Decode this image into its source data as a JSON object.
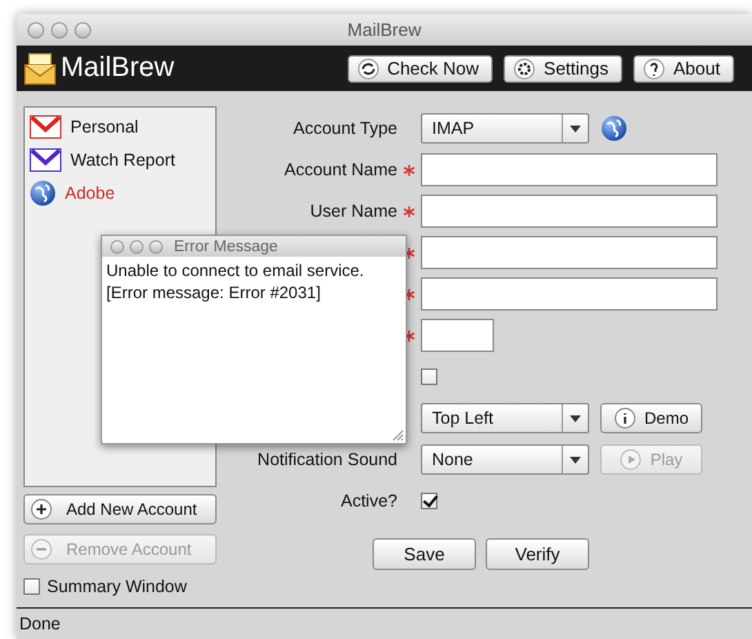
{
  "window": {
    "title": "MailBrew"
  },
  "header": {
    "app_name": "MailBrew",
    "buttons": [
      {
        "label": "Check Now",
        "kind": "refresh"
      },
      {
        "label": "Settings",
        "kind": "gear"
      },
      {
        "label": "About",
        "kind": "help"
      }
    ]
  },
  "accounts": [
    {
      "name": "Personal",
      "kind": "gmail",
      "error": false
    },
    {
      "name": "Watch Report",
      "kind": "mail",
      "error": false
    },
    {
      "name": "Adobe",
      "kind": "globe",
      "error": true
    }
  ],
  "account_buttons": [
    {
      "label": "Add New Account",
      "kind": "add",
      "disabled": false
    },
    {
      "label": "Remove Account",
      "kind": "remove",
      "disabled": true
    }
  ],
  "summary_window": {
    "label": "Summary Window",
    "checked": false
  },
  "form": {
    "rows": [
      {
        "kind": "service_select",
        "label": "Account Type",
        "required": false,
        "value": "IMAP"
      },
      {
        "kind": "text",
        "label": "Account Name",
        "required": true
      },
      {
        "kind": "text",
        "label": "User Name",
        "required": true
      },
      {
        "kind": "text",
        "required": true
      },
      {
        "kind": "text",
        "required": true
      },
      {
        "kind": "short",
        "required": true
      },
      {
        "kind": "checkbox",
        "checked": false
      },
      {
        "kind": "select",
        "value": "Top Left",
        "button": {
          "label": "Demo",
          "kind": "info",
          "disabled": false
        }
      },
      {
        "kind": "select",
        "label": "Notification Sound",
        "value": "None",
        "button": {
          "label": "Play",
          "kind": "play",
          "disabled": true
        }
      },
      {
        "kind": "checkbox",
        "label": "Active?",
        "checked": true
      }
    ],
    "actions": [
      "Save",
      "Verify"
    ]
  },
  "error_dialog": {
    "title": "Error Message",
    "lines": [
      "Unable to connect to email service.",
      "[Error message: Error #2031]"
    ]
  },
  "status_bar": "Done"
}
